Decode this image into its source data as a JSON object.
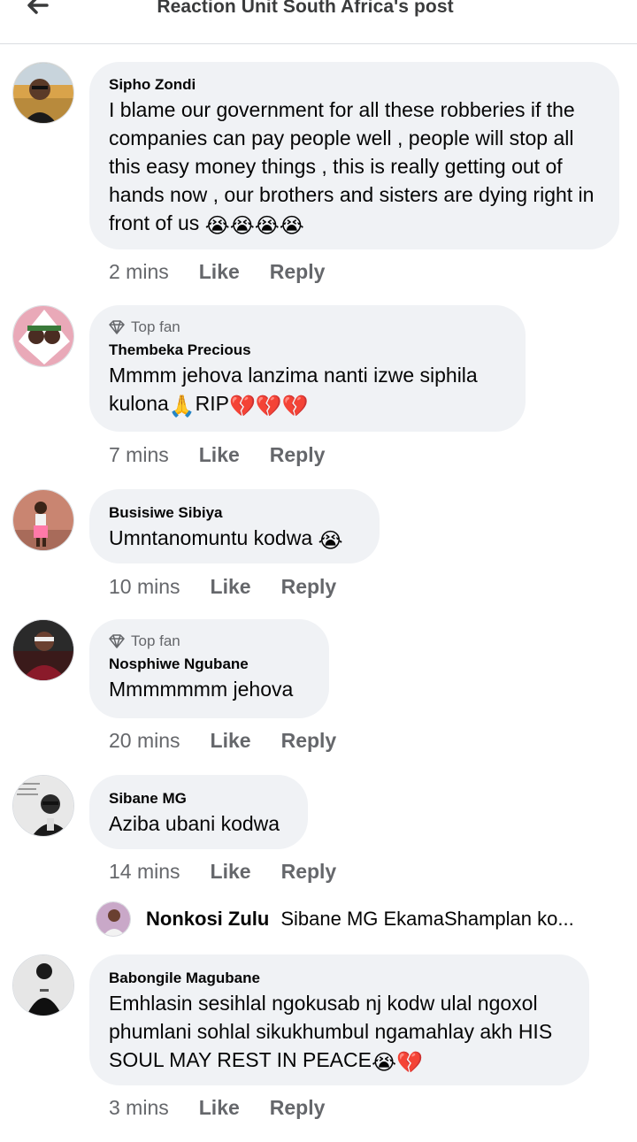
{
  "header": {
    "title": "Reaction Unit South Africa's post",
    "back_icon": "arrow-left-icon"
  },
  "comments": [
    {
      "author": "Sipho Zondi",
      "text": "I blame our government for all these robberies if the companies can pay people well , people will stop all this easy money things , this is really getting out of hands now , our brothers and sisters are dying right in front of us",
      "emoji": "😭😭😭😭",
      "time": "2 mins",
      "like": "Like",
      "reply": "Reply"
    },
    {
      "badge": "Top fan",
      "author": "Thembeka Precious",
      "text": "Mmmm jehova lanzima nanti izwe siphila kulona",
      "emoji_a": "🙏",
      "text_b": "RIP",
      "emoji_b": "💔💔💔",
      "time": "7 mins",
      "like": "Like",
      "reply": "Reply"
    },
    {
      "author": "Busisiwe Sibiya",
      "text": "Umntanomuntu kodwa",
      "emoji": "😭",
      "time": "10 mins",
      "like": "Like",
      "reply": "Reply"
    },
    {
      "badge": "Top fan",
      "author": "Nosphiwe Ngubane",
      "text": "Mmmmmmm jehova",
      "time": "20 mins",
      "like": "Like",
      "reply": "Reply"
    },
    {
      "author": "Sibane MG",
      "text": "Aziba ubani kodwa",
      "time": "14 mins",
      "like": "Like",
      "reply": "Reply"
    },
    {
      "author": "Babongile Magubane",
      "text": "Emhlasin sesihlal ngokusab nj kodw ulal ngoxol phumlani sohlal sikukhumbul ngamahlay akh HIS SOUL MAY REST IN PEACE",
      "emoji": "😭💔",
      "time": "3 mins",
      "like": "Like",
      "reply": "Reply"
    }
  ],
  "reply_preview": {
    "author": "Nonkosi Zulu",
    "snippet": "Sibane MG EkamaShamplan ko..."
  }
}
